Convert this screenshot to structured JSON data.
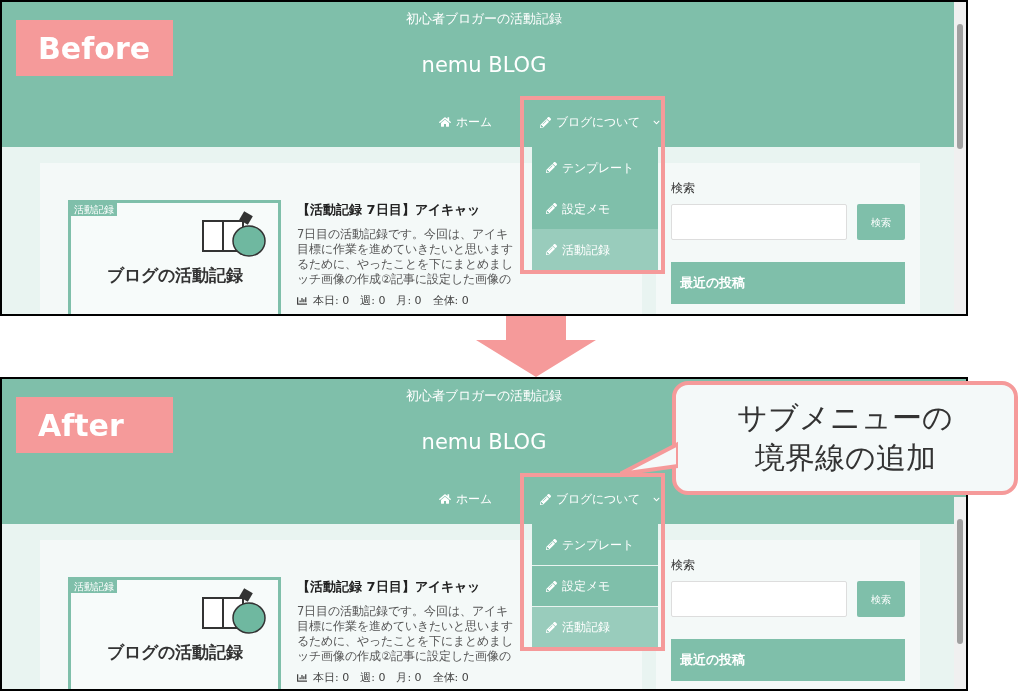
{
  "panels": [
    {
      "label": "Before",
      "tagline": "初心者ブロガーの活動記録",
      "site_title": "nemu BLOG",
      "nav": [
        {
          "kind": "home",
          "label": "ホーム",
          "has_submenu": false,
          "highlighted": false
        },
        {
          "kind": "pencil",
          "label": "ブログについて",
          "has_submenu": true,
          "highlighted": true
        }
      ],
      "submenu": {
        "dividers": false,
        "items": [
          {
            "label": "テンプレート",
            "selected": false
          },
          {
            "label": "設定メモ",
            "selected": false
          },
          {
            "label": "活動記録",
            "selected": true
          }
        ]
      },
      "post": {
        "category": "活動記録",
        "thumb_title": "ブログの活動記録",
        "title": "【活動記録 7日目】アイキャッ",
        "excerpt": [
          "7日目の活動記録です。今回は、アイキ",
          "目標に作業を進めていきたいと思います",
          "るために、やったことを下にまとめまし",
          "ッチ画像の作成②記事に設定した画像の"
        ],
        "stats": "本日: 0　週: 0　月: 0　全体: 0"
      },
      "sidebar": {
        "search_label": "検索",
        "search_button": "検索",
        "recent_heading": "最近の投稿"
      }
    },
    {
      "label": "After",
      "tagline": "初心者ブロガーの活動記録",
      "site_title": "nemu BLOG",
      "nav": [
        {
          "kind": "home",
          "label": "ホーム",
          "has_submenu": false,
          "highlighted": false
        },
        {
          "kind": "pencil",
          "label": "ブログについて",
          "has_submenu": true,
          "highlighted": true
        }
      ],
      "submenu": {
        "dividers": true,
        "items": [
          {
            "label": "テンプレート",
            "selected": false
          },
          {
            "label": "設定メモ",
            "selected": false
          },
          {
            "label": "活動記録",
            "selected": true
          }
        ]
      },
      "post": {
        "category": "活動記録",
        "thumb_title": "ブログの活動記録",
        "title": "【活動記録 7日目】アイキャッ",
        "excerpt": [
          "7日目の活動記録です。今回は、アイキ",
          "目標に作業を進めていきたいと思います",
          "るために、やったことを下にまとめまし",
          "ッチ画像の作成②記事に設定した画像の"
        ],
        "stats": "本日: 0　週: 0　月: 0　全体: 0"
      },
      "sidebar": {
        "search_label": "検索",
        "search_button": "検索",
        "recent_heading": "最近の投稿"
      }
    }
  ],
  "callout": {
    "lines": [
      "サブメニューの",
      "境界線の追加"
    ]
  }
}
